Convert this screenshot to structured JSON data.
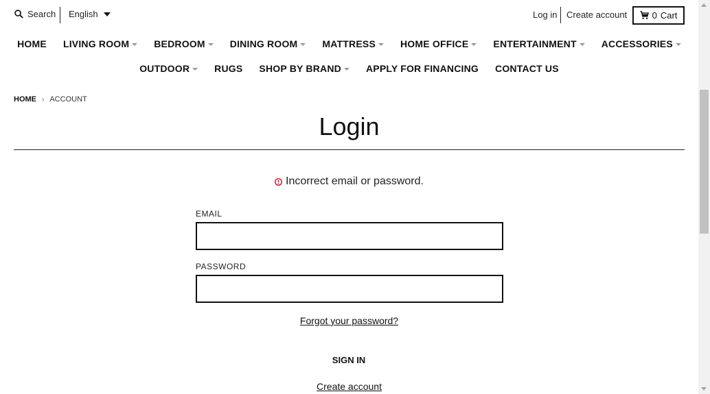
{
  "header": {
    "search_label": "Search",
    "language": "English",
    "login_label": "Log in",
    "create_account_label": "Create account",
    "cart_count": "0",
    "cart_label": "Cart"
  },
  "nav": {
    "row1": [
      {
        "label": "HOME",
        "dropdown": false
      },
      {
        "label": "LIVING ROOM",
        "dropdown": true
      },
      {
        "label": "BEDROOM",
        "dropdown": true
      },
      {
        "label": "DINING ROOM",
        "dropdown": true
      },
      {
        "label": "MATTRESS",
        "dropdown": true
      },
      {
        "label": "HOME OFFICE",
        "dropdown": true
      },
      {
        "label": "ENTERTAINMENT",
        "dropdown": true
      },
      {
        "label": "ACCESSORIES",
        "dropdown": true
      }
    ],
    "row2": [
      {
        "label": "OUTDOOR",
        "dropdown": true
      },
      {
        "label": "RUGS",
        "dropdown": false
      },
      {
        "label": "SHOP BY BRAND",
        "dropdown": true
      },
      {
        "label": "APPLY FOR FINANCING",
        "dropdown": false
      },
      {
        "label": "CONTACT US",
        "dropdown": false
      }
    ]
  },
  "breadcrumb": {
    "home": "HOME",
    "separator": "›",
    "current": "ACCOUNT"
  },
  "page": {
    "title": "Login",
    "error_message": "Incorrect email or password.",
    "error_color": "#d0021b",
    "email_label": "EMAIL",
    "email_value": "",
    "password_label": "PASSWORD",
    "password_value": "",
    "forgot_password": "Forgot your password?",
    "sign_in": "SIGN IN",
    "create_account": "Create account"
  }
}
